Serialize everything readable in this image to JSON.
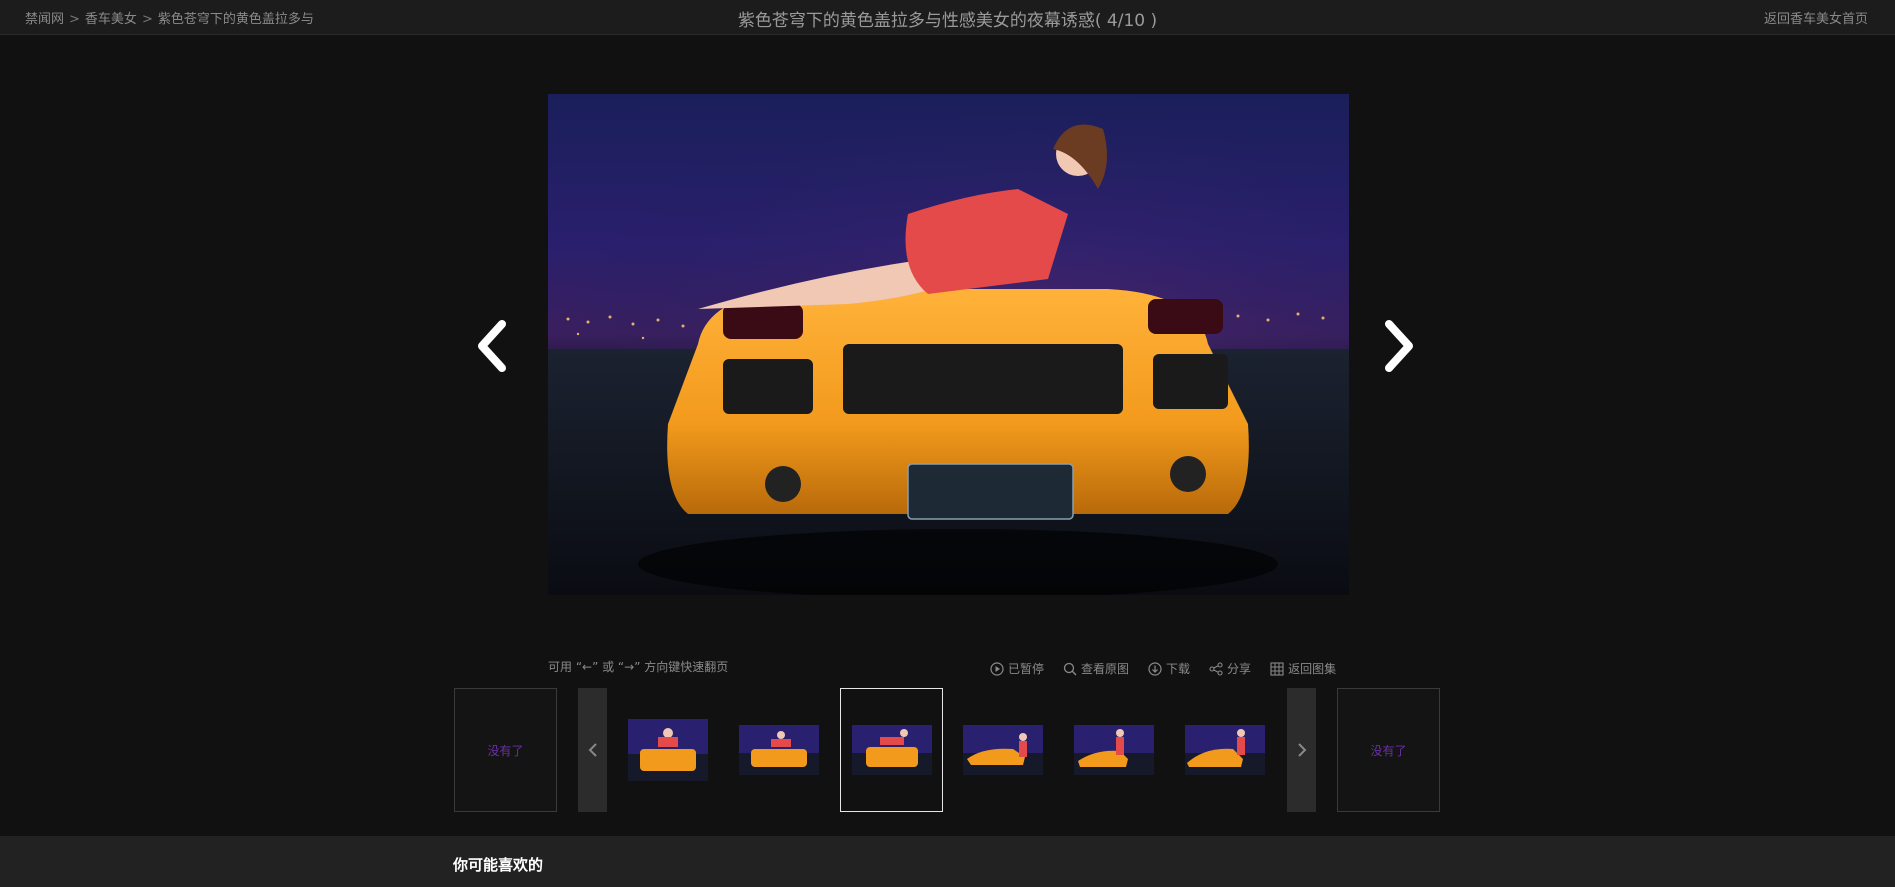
{
  "breadcrumb": {
    "items": [
      "禁闻网",
      "香车美女",
      "紫色苍穹下的黄色盖拉多与"
    ],
    "separator": ">"
  },
  "gallery": {
    "title": "紫色苍穹下的黄色盖拉多与性感美女的夜幕诱惑",
    "counter": "( 4/10 )",
    "back_home": "返回香车美女首页"
  },
  "viewer": {
    "hint": "可用 “←” 或 “→” 方向键快速翻页",
    "tools": [
      {
        "icon": "play-circle-icon",
        "label": "已暂停"
      },
      {
        "icon": "search-icon",
        "label": "查看原图"
      },
      {
        "icon": "download-icon",
        "label": "下载"
      },
      {
        "icon": "share-icon",
        "label": "分享"
      },
      {
        "icon": "grid-icon",
        "label": "返回图集"
      }
    ]
  },
  "filmstrip": {
    "prev_end": "没有了",
    "next_end": "没有了",
    "active_index": 2,
    "thumb_count": 6
  },
  "recommend": {
    "title": "你可能喜欢的"
  },
  "colors": {
    "page_bg": "#111111",
    "accent_purple": "#6a2fa8",
    "car_orange": "#f29a1c"
  }
}
